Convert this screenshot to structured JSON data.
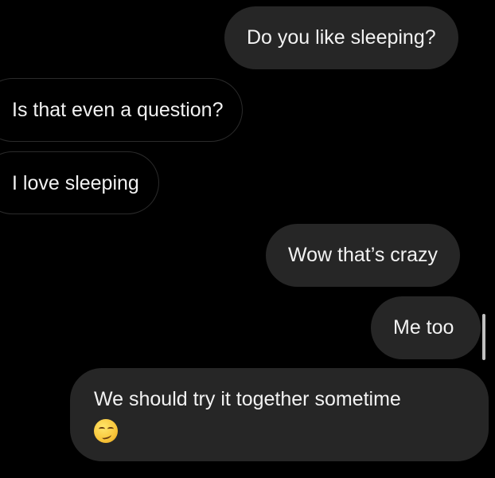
{
  "messages": [
    {
      "direction": "sent",
      "text": "Do you like sleeping?"
    },
    {
      "direction": "received",
      "text": "Is that even a question?"
    },
    {
      "direction": "received",
      "text": "I love sleeping"
    },
    {
      "direction": "sent",
      "text": "Wow that’s crazy"
    },
    {
      "direction": "sent",
      "text": "Me too"
    },
    {
      "direction": "sent",
      "text": "We should try it together sometime",
      "emoji": "smirking-face-icon"
    }
  ],
  "colors": {
    "background": "#000000",
    "sent_bubble": "#262626",
    "received_border": "#2b2b2b",
    "text": "#f2f2f2"
  }
}
